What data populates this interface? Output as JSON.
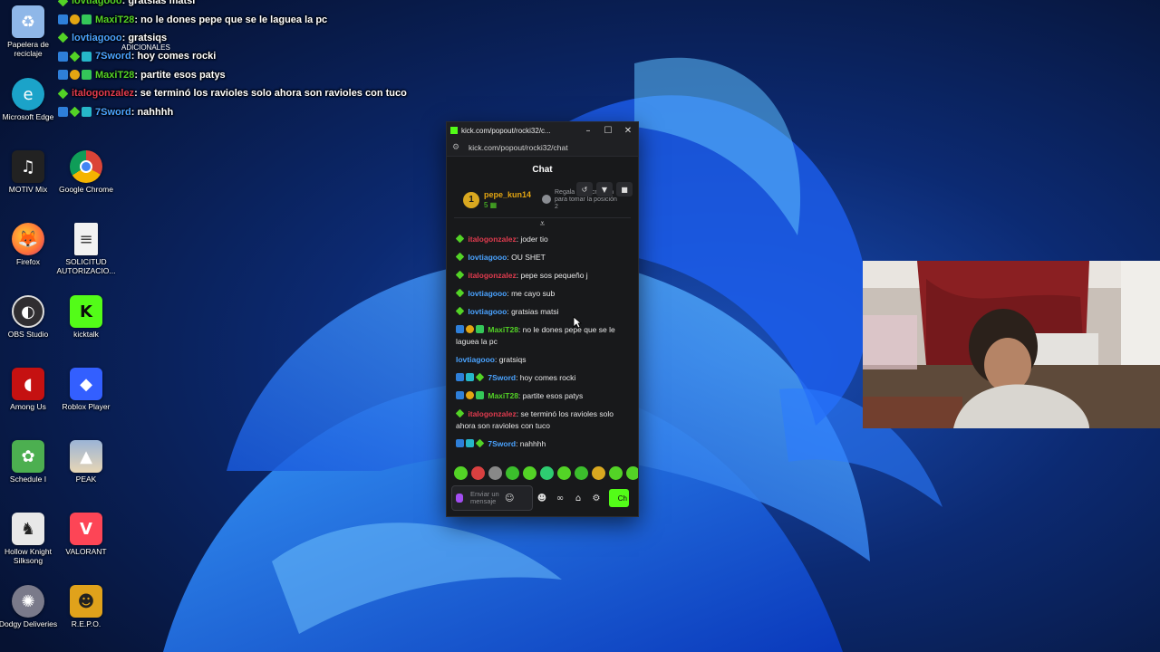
{
  "desktop": {
    "icons": [
      {
        "label": "Papelera de reciclaje",
        "icon": "recycle-bin-icon",
        "color": "#8fb7e8"
      },
      {
        "label": "Microsoft Edge",
        "icon": "edge-icon",
        "color": "#1ba3c9"
      },
      {
        "label": "MOTIV Mix",
        "icon": "motiv-mix-icon",
        "color": "#222222"
      },
      {
        "label": "Google Chrome",
        "icon": "chrome-icon",
        "color": "#db4437"
      },
      {
        "label": "Firefox",
        "icon": "firefox-icon",
        "color": "#ff7139"
      },
      {
        "label": "SOLICITUD AUTORIZACIO...",
        "icon": "document-icon",
        "color": "#f2f2f2"
      },
      {
        "label": "OBS Studio",
        "icon": "obs-icon",
        "color": "#302e31"
      },
      {
        "label": "kicktalk",
        "icon": "kicktalk-icon",
        "color": "#53fc18"
      },
      {
        "label": "Among Us",
        "icon": "among-us-icon",
        "color": "#c51111"
      },
      {
        "label": "Roblox Player",
        "icon": "roblox-icon",
        "color": "#335fff"
      },
      {
        "label": "Schedule I",
        "icon": "schedule-icon",
        "color": "#4caf50"
      },
      {
        "label": "PEAK",
        "icon": "peak-icon",
        "color": "#9bb4d6"
      },
      {
        "label": "Hollow Knight Silksong",
        "icon": "hollow-knight-icon",
        "color": "#e8e8e8"
      },
      {
        "label": "VALORANT",
        "icon": "valorant-icon",
        "color": "#fd4556"
      },
      {
        "label": "Dodgy Deliveries",
        "icon": "dodgy-deliveries-icon",
        "color": "#7a7a8a"
      },
      {
        "label": "R.E.P.O.",
        "icon": "repo-icon",
        "color": "#e0a21b"
      }
    ],
    "partial_label": "ADICIONALES"
  },
  "overlay_chat": [
    {
      "user": "lovtiagooo",
      "text": ": gratsias matsi",
      "color": "#53d326",
      "badges": [
        "b-green"
      ]
    },
    {
      "user": "MaxiT28",
      "text": ": no le dones pepe que se le laguea la pc",
      "color": "#53d326",
      "badges": [
        "b-blue",
        "b-gold",
        "b-gift"
      ]
    },
    {
      "user": "lovtiagooo",
      "text": ": gratsiqs",
      "color": "#4aa3ff",
      "badges": [
        "b-green"
      ]
    },
    {
      "user": "7Sword",
      "text": ": hoy comes rocki",
      "color": "#4aa3ff",
      "badges": [
        "b-blue",
        "b-green",
        "b-teal"
      ]
    },
    {
      "user": "MaxiT28",
      "text": ": partite esos patys",
      "color": "#53d326",
      "badges": [
        "b-blue",
        "b-gold",
        "b-gift"
      ]
    },
    {
      "user": "italogonzalez",
      "text": ": se terminó los ravioles solo ahora son ravioles con tuco",
      "color": "#e03b4e",
      "badges": [
        "b-green"
      ]
    },
    {
      "user": "7Sword",
      "text": ": nahhhh",
      "color": "#4aa3ff",
      "badges": [
        "b-blue",
        "b-green",
        "b-teal"
      ]
    }
  ],
  "browser": {
    "title": "kick.com/popout/rocki32/c...",
    "url": "kick.com/popout/rocki32/chat",
    "chat_title": "Chat",
    "pinned": {
      "rank": "1",
      "user": "pepe_kun14",
      "count": "5",
      "gift_text": "Regala 1 suscripción para tomar la posición 2"
    },
    "messages": [
      {
        "user": "italogonzalez",
        "text": ": joder tio",
        "color": "#e03b4e",
        "badges": [
          "b-green"
        ]
      },
      {
        "user": "lovtiagooo",
        "text": ": OU SHET",
        "color": "#4aa3ff",
        "badges": [
          "b-green"
        ]
      },
      {
        "user": "italogonzalez",
        "text": ": pepe sos pequeño j",
        "color": "#e03b4e",
        "badges": [
          "b-green"
        ]
      },
      {
        "user": "lovtiagooo",
        "text": ": me cayo sub",
        "color": "#4aa3ff",
        "badges": [
          "b-green"
        ]
      },
      {
        "user": "lovtiagooo",
        "text": ": gratsias matsi",
        "color": "#4aa3ff",
        "badges": [
          "b-green"
        ]
      },
      {
        "user": "MaxiT28",
        "text": ": no le dones pepe que se le laguea la pc",
        "color": "#53d326",
        "badges": [
          "b-blue",
          "b-gold",
          "b-gift"
        ]
      },
      {
        "user": "lovtiagooo",
        "text": ": gratsiqs",
        "color": "#4aa3ff",
        "badges": []
      },
      {
        "user": "7Sword",
        "text": ": hoy comes rocki",
        "color": "#4aa3ff",
        "badges": [
          "b-blue",
          "b-teal",
          "b-green"
        ]
      },
      {
        "user": "MaxiT28",
        "text": ": partite esos patys",
        "color": "#53d326",
        "badges": [
          "b-blue",
          "b-gold",
          "b-gift"
        ]
      },
      {
        "user": "italogonzalez",
        "text": ": se terminó los ravioles solo ahora son ravioles con tuco",
        "color": "#e03b4e",
        "badges": [
          "b-green"
        ]
      },
      {
        "user": "7Sword",
        "text": ": nahhhh",
        "color": "#4aa3ff",
        "badges": [
          "b-blue",
          "b-teal",
          "b-green"
        ]
      }
    ],
    "emote_colors": [
      "#53d326",
      "#d94040",
      "#888888",
      "#3bbf2c",
      "#53d326",
      "#2ecc71",
      "#53d326",
      "#3bbf2c",
      "#d9a820",
      "#53d326",
      "#53d326"
    ],
    "input_placeholder": "Enviar un mensaje",
    "send_label": "Ch"
  }
}
